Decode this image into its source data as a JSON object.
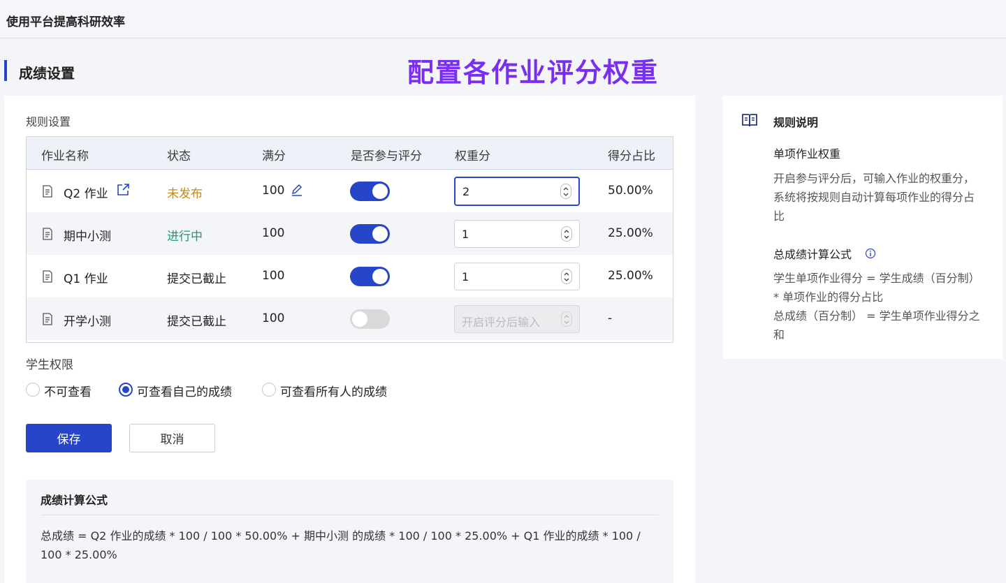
{
  "topbar": {
    "title": "使用平台提高科研效率"
  },
  "page": {
    "section_title": "成绩设置",
    "banner": "配置各作业评分权重"
  },
  "rules": {
    "label": "规则设置",
    "columns": [
      "作业名称",
      "状态",
      "满分",
      "是否参与评分",
      "权重分",
      "得分占比"
    ],
    "rows": [
      {
        "name": "Q2 作业",
        "status": "未发布",
        "full_score": "100",
        "enabled": true,
        "weight": "2",
        "ratio": "50.00%"
      },
      {
        "name": "期中小测",
        "status": "进行中",
        "full_score": "100",
        "enabled": true,
        "weight": "1",
        "ratio": "25.00%"
      },
      {
        "name": "Q1 作业",
        "status": "提交已截止",
        "full_score": "100",
        "enabled": true,
        "weight": "1",
        "ratio": "25.00%"
      },
      {
        "name": "开学小测",
        "status": "提交已截止",
        "full_score": "100",
        "enabled": false,
        "weight_placeholder": "开启评分后输入",
        "ratio": "-"
      }
    ]
  },
  "permissions": {
    "label": "学生权限",
    "options": [
      "不可查看",
      "可查看自己的成绩",
      "可查看所有人的成绩"
    ],
    "selected": "可查看自己的成绩"
  },
  "actions": {
    "save": "保存",
    "cancel": "取消"
  },
  "formula": {
    "title": "成绩计算公式",
    "text": "总成绩 = Q2 作业的成绩 * 100 / 100 * 50.00% + 期中小测 的成绩 * 100 / 100 * 25.00% + Q1 作业的成绩 * 100 / 100 * 25.00%"
  },
  "side": {
    "title": "规则说明",
    "h1": "单项作业权重",
    "p1": "开启参与评分后，可输入作业的权重分，系统将按规则自动计算每项作业的得分占比",
    "h2": "总成绩计算公式",
    "p2a": "学生单项作业得分 = 学生成绩（百分制） * 单项作业的得分占比",
    "p2b": "总成绩（百分制） = 学生单项作业得分之和"
  },
  "colors": {
    "accent": "#2745c8",
    "banner": "#7a2ff0",
    "status_draft": "#c68a11",
    "status_running": "#1a9a7c"
  }
}
